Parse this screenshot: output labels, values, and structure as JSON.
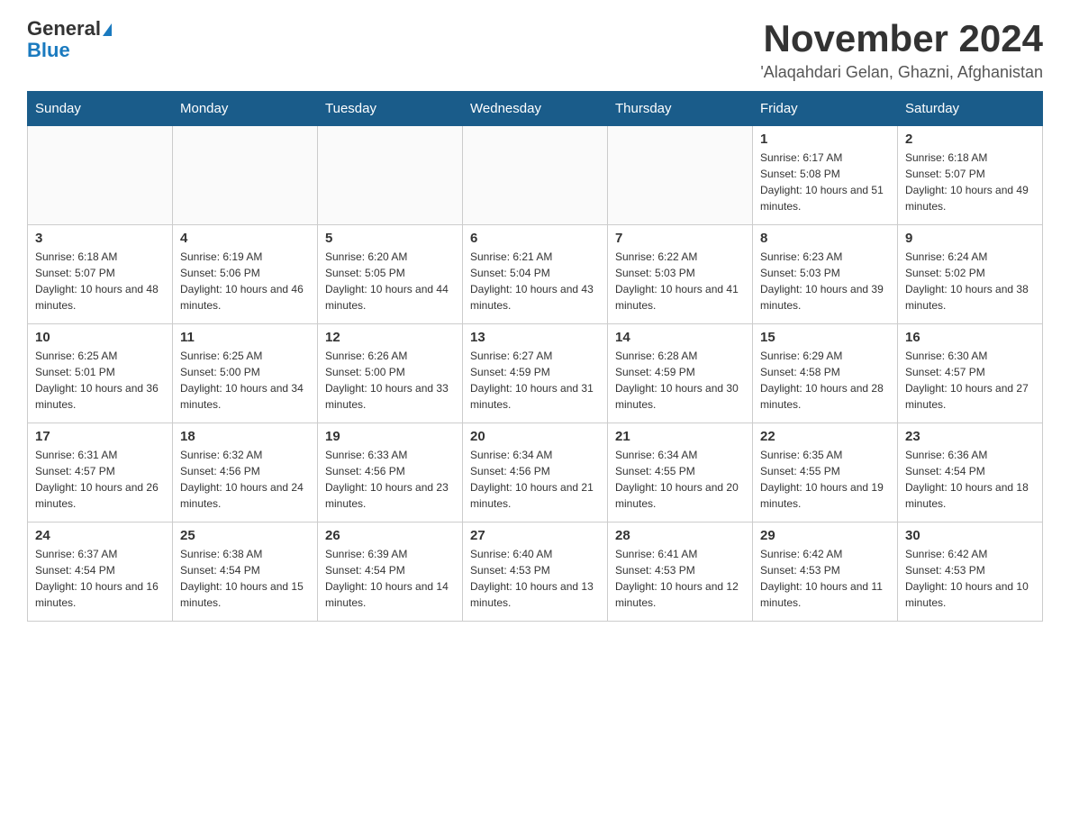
{
  "header": {
    "logo_general": "General",
    "logo_blue": "Blue",
    "title": "November 2024",
    "subtitle": "'Alaqahdari Gelan, Ghazni, Afghanistan"
  },
  "calendar": {
    "days_of_week": [
      "Sunday",
      "Monday",
      "Tuesday",
      "Wednesday",
      "Thursday",
      "Friday",
      "Saturday"
    ],
    "weeks": [
      [
        {
          "day": "",
          "sunrise": "",
          "sunset": "",
          "daylight": "",
          "empty": true
        },
        {
          "day": "",
          "sunrise": "",
          "sunset": "",
          "daylight": "",
          "empty": true
        },
        {
          "day": "",
          "sunrise": "",
          "sunset": "",
          "daylight": "",
          "empty": true
        },
        {
          "day": "",
          "sunrise": "",
          "sunset": "",
          "daylight": "",
          "empty": true
        },
        {
          "day": "",
          "sunrise": "",
          "sunset": "",
          "daylight": "",
          "empty": true
        },
        {
          "day": "1",
          "sunrise": "Sunrise: 6:17 AM",
          "sunset": "Sunset: 5:08 PM",
          "daylight": "Daylight: 10 hours and 51 minutes."
        },
        {
          "day": "2",
          "sunrise": "Sunrise: 6:18 AM",
          "sunset": "Sunset: 5:07 PM",
          "daylight": "Daylight: 10 hours and 49 minutes."
        }
      ],
      [
        {
          "day": "3",
          "sunrise": "Sunrise: 6:18 AM",
          "sunset": "Sunset: 5:07 PM",
          "daylight": "Daylight: 10 hours and 48 minutes."
        },
        {
          "day": "4",
          "sunrise": "Sunrise: 6:19 AM",
          "sunset": "Sunset: 5:06 PM",
          "daylight": "Daylight: 10 hours and 46 minutes."
        },
        {
          "day": "5",
          "sunrise": "Sunrise: 6:20 AM",
          "sunset": "Sunset: 5:05 PM",
          "daylight": "Daylight: 10 hours and 44 minutes."
        },
        {
          "day": "6",
          "sunrise": "Sunrise: 6:21 AM",
          "sunset": "Sunset: 5:04 PM",
          "daylight": "Daylight: 10 hours and 43 minutes."
        },
        {
          "day": "7",
          "sunrise": "Sunrise: 6:22 AM",
          "sunset": "Sunset: 5:03 PM",
          "daylight": "Daylight: 10 hours and 41 minutes."
        },
        {
          "day": "8",
          "sunrise": "Sunrise: 6:23 AM",
          "sunset": "Sunset: 5:03 PM",
          "daylight": "Daylight: 10 hours and 39 minutes."
        },
        {
          "day": "9",
          "sunrise": "Sunrise: 6:24 AM",
          "sunset": "Sunset: 5:02 PM",
          "daylight": "Daylight: 10 hours and 38 minutes."
        }
      ],
      [
        {
          "day": "10",
          "sunrise": "Sunrise: 6:25 AM",
          "sunset": "Sunset: 5:01 PM",
          "daylight": "Daylight: 10 hours and 36 minutes."
        },
        {
          "day": "11",
          "sunrise": "Sunrise: 6:25 AM",
          "sunset": "Sunset: 5:00 PM",
          "daylight": "Daylight: 10 hours and 34 minutes."
        },
        {
          "day": "12",
          "sunrise": "Sunrise: 6:26 AM",
          "sunset": "Sunset: 5:00 PM",
          "daylight": "Daylight: 10 hours and 33 minutes."
        },
        {
          "day": "13",
          "sunrise": "Sunrise: 6:27 AM",
          "sunset": "Sunset: 4:59 PM",
          "daylight": "Daylight: 10 hours and 31 minutes."
        },
        {
          "day": "14",
          "sunrise": "Sunrise: 6:28 AM",
          "sunset": "Sunset: 4:59 PM",
          "daylight": "Daylight: 10 hours and 30 minutes."
        },
        {
          "day": "15",
          "sunrise": "Sunrise: 6:29 AM",
          "sunset": "Sunset: 4:58 PM",
          "daylight": "Daylight: 10 hours and 28 minutes."
        },
        {
          "day": "16",
          "sunrise": "Sunrise: 6:30 AM",
          "sunset": "Sunset: 4:57 PM",
          "daylight": "Daylight: 10 hours and 27 minutes."
        }
      ],
      [
        {
          "day": "17",
          "sunrise": "Sunrise: 6:31 AM",
          "sunset": "Sunset: 4:57 PM",
          "daylight": "Daylight: 10 hours and 26 minutes."
        },
        {
          "day": "18",
          "sunrise": "Sunrise: 6:32 AM",
          "sunset": "Sunset: 4:56 PM",
          "daylight": "Daylight: 10 hours and 24 minutes."
        },
        {
          "day": "19",
          "sunrise": "Sunrise: 6:33 AM",
          "sunset": "Sunset: 4:56 PM",
          "daylight": "Daylight: 10 hours and 23 minutes."
        },
        {
          "day": "20",
          "sunrise": "Sunrise: 6:34 AM",
          "sunset": "Sunset: 4:56 PM",
          "daylight": "Daylight: 10 hours and 21 minutes."
        },
        {
          "day": "21",
          "sunrise": "Sunrise: 6:34 AM",
          "sunset": "Sunset: 4:55 PM",
          "daylight": "Daylight: 10 hours and 20 minutes."
        },
        {
          "day": "22",
          "sunrise": "Sunrise: 6:35 AM",
          "sunset": "Sunset: 4:55 PM",
          "daylight": "Daylight: 10 hours and 19 minutes."
        },
        {
          "day": "23",
          "sunrise": "Sunrise: 6:36 AM",
          "sunset": "Sunset: 4:54 PM",
          "daylight": "Daylight: 10 hours and 18 minutes."
        }
      ],
      [
        {
          "day": "24",
          "sunrise": "Sunrise: 6:37 AM",
          "sunset": "Sunset: 4:54 PM",
          "daylight": "Daylight: 10 hours and 16 minutes."
        },
        {
          "day": "25",
          "sunrise": "Sunrise: 6:38 AM",
          "sunset": "Sunset: 4:54 PM",
          "daylight": "Daylight: 10 hours and 15 minutes."
        },
        {
          "day": "26",
          "sunrise": "Sunrise: 6:39 AM",
          "sunset": "Sunset: 4:54 PM",
          "daylight": "Daylight: 10 hours and 14 minutes."
        },
        {
          "day": "27",
          "sunrise": "Sunrise: 6:40 AM",
          "sunset": "Sunset: 4:53 PM",
          "daylight": "Daylight: 10 hours and 13 minutes."
        },
        {
          "day": "28",
          "sunrise": "Sunrise: 6:41 AM",
          "sunset": "Sunset: 4:53 PM",
          "daylight": "Daylight: 10 hours and 12 minutes."
        },
        {
          "day": "29",
          "sunrise": "Sunrise: 6:42 AM",
          "sunset": "Sunset: 4:53 PM",
          "daylight": "Daylight: 10 hours and 11 minutes."
        },
        {
          "day": "30",
          "sunrise": "Sunrise: 6:42 AM",
          "sunset": "Sunset: 4:53 PM",
          "daylight": "Daylight: 10 hours and 10 minutes."
        }
      ]
    ]
  }
}
